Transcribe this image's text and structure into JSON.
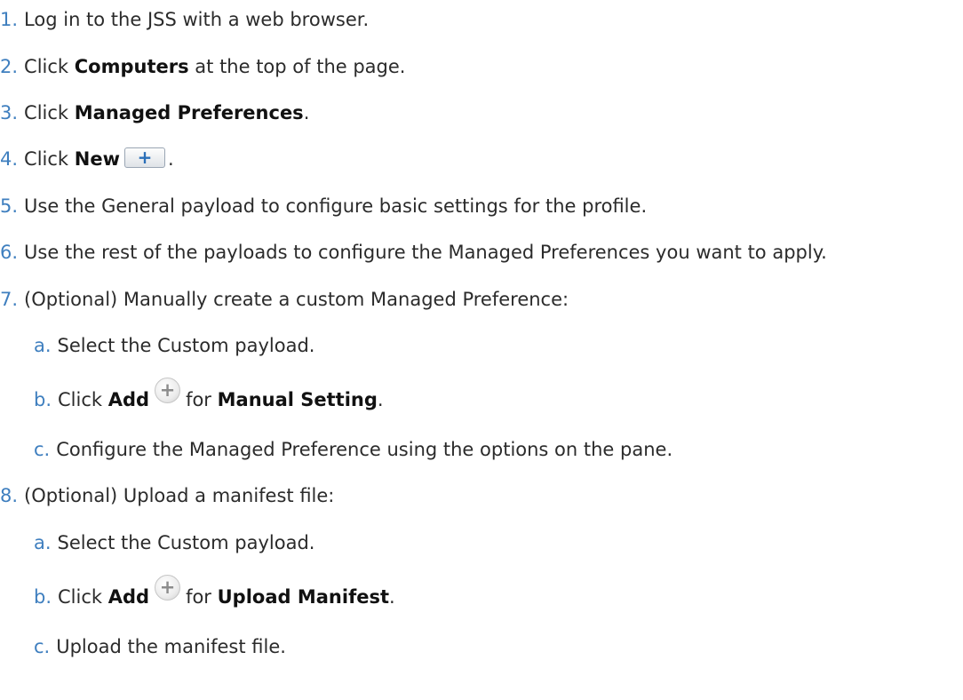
{
  "steps": [
    {
      "num": "1.",
      "text": "Log in to the JSS with a web browser."
    },
    {
      "num": "2.",
      "pre": "Click ",
      "bold": "Computers",
      "post": " at the top of the page."
    },
    {
      "num": "3.",
      "pre": "Click ",
      "bold": "Managed Preferences",
      "post": "."
    },
    {
      "num": "4.",
      "pre": "Click ",
      "bold": "New",
      "icon": "+",
      "post": "."
    },
    {
      "num": "5.",
      "text": "Use the General payload to configure basic settings for the profile."
    },
    {
      "num": "6.",
      "text": "Use the rest of the payloads to configure the Managed Preferences you want to apply."
    },
    {
      "num": "7.",
      "text": "(Optional) Manually create a custom Managed Preference:",
      "sub": [
        {
          "num": "a.",
          "text": "Select the Custom payload."
        },
        {
          "num": "b.",
          "pre": "Click ",
          "bold": "Add",
          "icon": "+",
          "mid": "for ",
          "bold2": "Manual Setting",
          "post": "."
        },
        {
          "num": "c.",
          "text": "Configure the Managed Preference using the options on the pane."
        }
      ]
    },
    {
      "num": "8.",
      "text": "(Optional) Upload a manifest file:",
      "sub": [
        {
          "num": "a.",
          "text": "Select the Custom payload."
        },
        {
          "num": "b.",
          "pre": "Click ",
          "bold": "Add",
          "icon": "+",
          "mid": "for ",
          "bold2": "Upload Manifest",
          "post": "."
        },
        {
          "num": "c.",
          "text": "Upload the manifest file."
        }
      ]
    }
  ],
  "icons": {
    "new_button": "plus-icon",
    "add_button": "add-circle-icon"
  }
}
